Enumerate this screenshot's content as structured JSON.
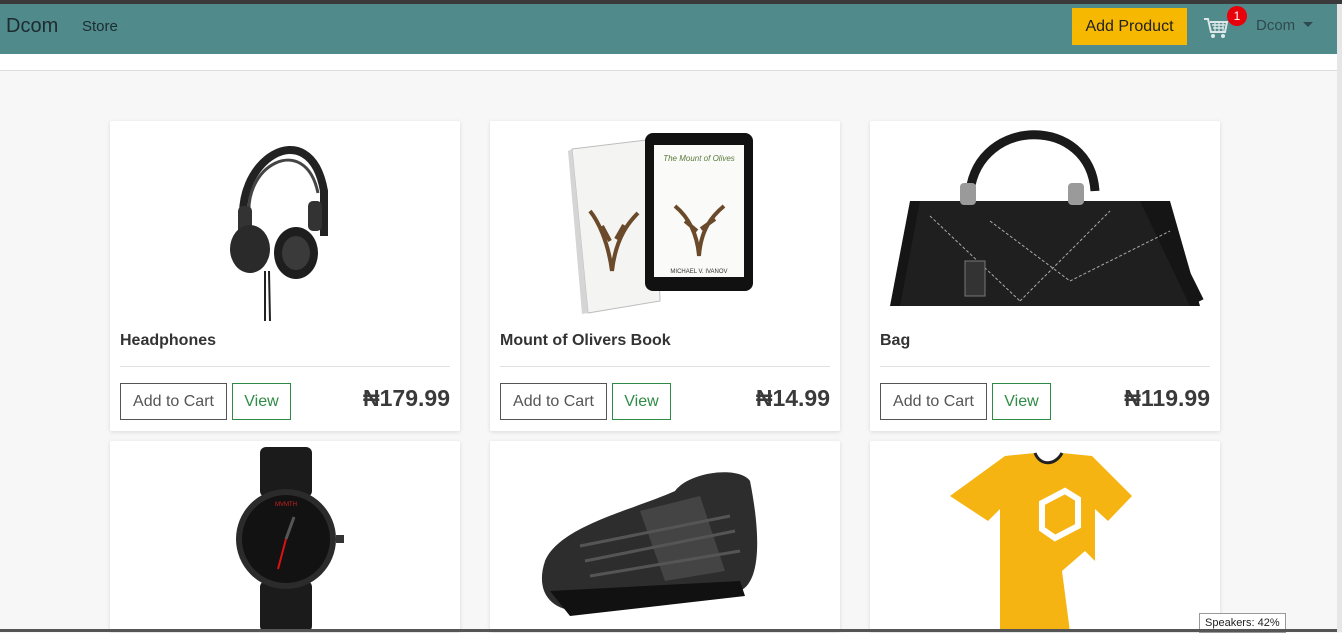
{
  "navbar": {
    "brand": "Dcom",
    "store_link": "Store",
    "add_product_label": "Add Product",
    "cart_count": "1",
    "user_label": "Dcom",
    "background": "#518a8b",
    "accent": "#f6b800"
  },
  "products": [
    {
      "name": "Headphones",
      "price": "₦179.99",
      "add_label": "Add to Cart",
      "view_label": "View",
      "image": "headphones-image"
    },
    {
      "name": "Mount of Olivers Book",
      "price": "₦14.99",
      "add_label": "Add to Cart",
      "view_label": "View",
      "image": "book-image"
    },
    {
      "name": "Bag",
      "price": "₦119.99",
      "add_label": "Add to Cart",
      "view_label": "View",
      "image": "bag-image"
    },
    {
      "name": "",
      "price": "",
      "add_label": "",
      "view_label": "",
      "image": "watch-image"
    },
    {
      "name": "",
      "price": "",
      "add_label": "",
      "view_label": "",
      "image": "shoe-image"
    },
    {
      "name": "",
      "price": "",
      "add_label": "",
      "view_label": "",
      "image": "tshirt-image"
    }
  ],
  "book_cover": {
    "title": "The Mount of Olives",
    "author": "MICHAEL V. IVANOV"
  },
  "watch_brand": "MVMTH",
  "tooltip": "Speakers: 42%"
}
